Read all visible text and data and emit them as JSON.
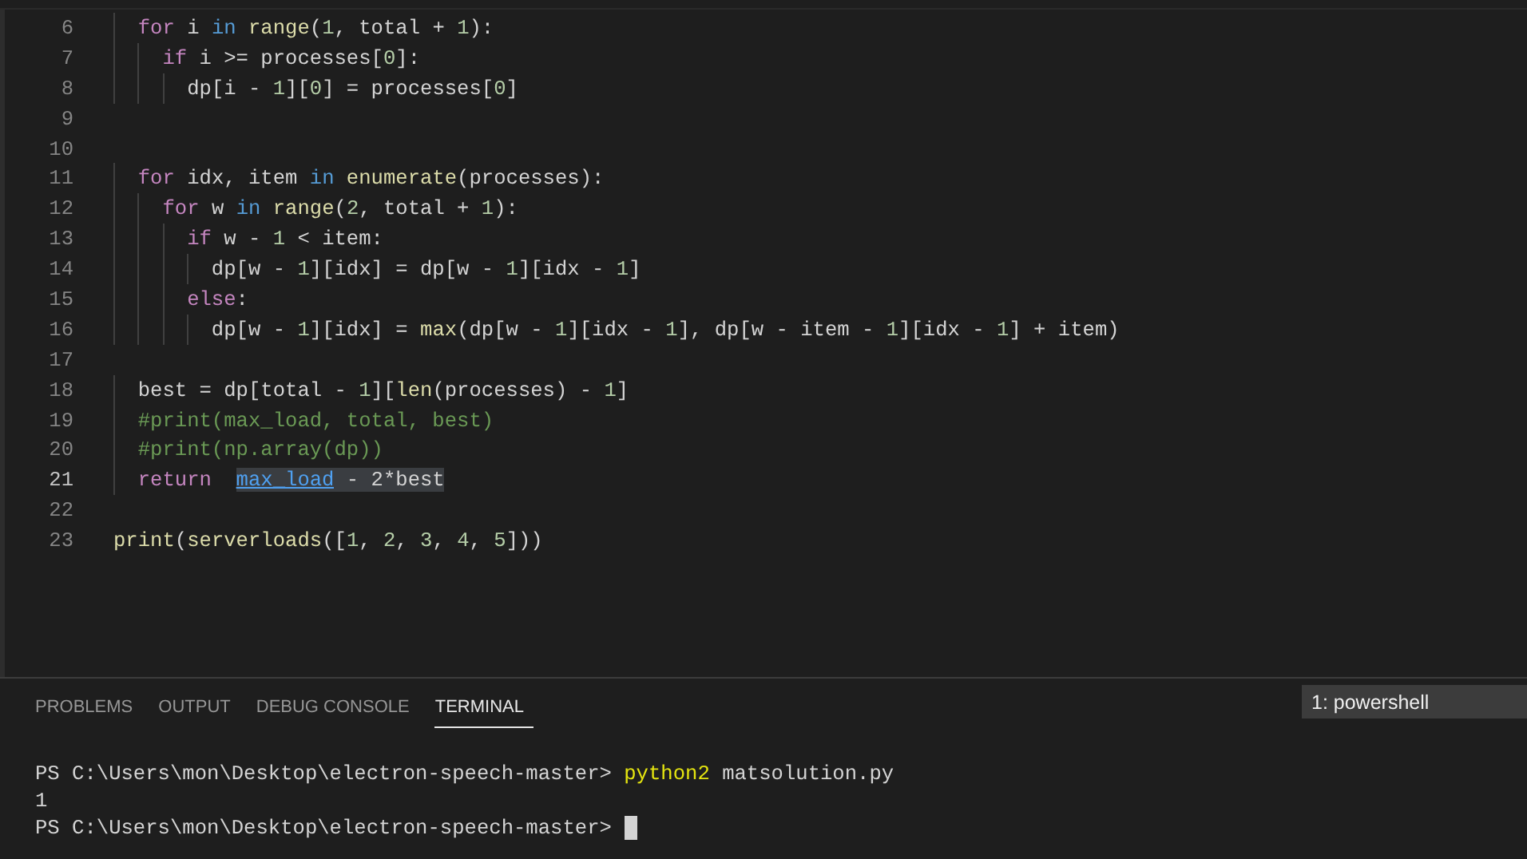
{
  "editor": {
    "lines": [
      {
        "number": "6",
        "current": false,
        "tokens": [
          {
            "t": "  for",
            "kind": "kw"
          },
          {
            "t": " i ",
            "kind": "tx"
          },
          {
            "t": "in",
            "kind": "op"
          },
          {
            "t": " range",
            "kind": "fn"
          },
          {
            "t": "(",
            "kind": "tx"
          },
          {
            "t": "1",
            "kind": "num"
          },
          {
            "t": ", total + ",
            "kind": "tx"
          },
          {
            "t": "1",
            "kind": "num"
          },
          {
            "t": "):",
            "kind": "tx"
          }
        ]
      },
      {
        "number": "7",
        "current": false,
        "tokens": [
          {
            "t": "    if",
            "kind": "kw"
          },
          {
            "t": " i >= processes[",
            "kind": "tx"
          },
          {
            "t": "0",
            "kind": "num"
          },
          {
            "t": "]:",
            "kind": "tx"
          }
        ]
      },
      {
        "number": "8",
        "current": false,
        "tokens": [
          {
            "t": "      dp[i - ",
            "kind": "tx"
          },
          {
            "t": "1",
            "kind": "num"
          },
          {
            "t": "][",
            "kind": "tx"
          },
          {
            "t": "0",
            "kind": "num"
          },
          {
            "t": "] = processes[",
            "kind": "tx"
          },
          {
            "t": "0",
            "kind": "num"
          },
          {
            "t": "]",
            "kind": "tx"
          }
        ]
      },
      {
        "number": "9",
        "current": false
      },
      {
        "number": "10",
        "current": false
      },
      {
        "number": "11",
        "current": false,
        "tokens": [
          {
            "t": "  for",
            "kind": "kw"
          },
          {
            "t": " idx, item ",
            "kind": "tx"
          },
          {
            "t": "in",
            "kind": "op"
          },
          {
            "t": " enumerate",
            "kind": "fn"
          },
          {
            "t": "(processes):",
            "kind": "tx"
          }
        ]
      },
      {
        "number": "12",
        "current": false,
        "tokens": [
          {
            "t": "    for",
            "kind": "kw"
          },
          {
            "t": " w ",
            "kind": "tx"
          },
          {
            "t": "in",
            "kind": "op"
          },
          {
            "t": " range",
            "kind": "fn"
          },
          {
            "t": "(",
            "kind": "tx"
          },
          {
            "t": "2",
            "kind": "num"
          },
          {
            "t": ", total + ",
            "kind": "tx"
          },
          {
            "t": "1",
            "kind": "num"
          },
          {
            "t": "):",
            "kind": "tx"
          }
        ]
      },
      {
        "number": "13",
        "current": false,
        "tokens": [
          {
            "t": "      if",
            "kind": "kw"
          },
          {
            "t": " w - ",
            "kind": "tx"
          },
          {
            "t": "1",
            "kind": "num"
          },
          {
            "t": " < item:",
            "kind": "tx"
          }
        ]
      },
      {
        "number": "14",
        "current": false,
        "tokens": [
          {
            "t": "        dp[w - ",
            "kind": "tx"
          },
          {
            "t": "1",
            "kind": "num"
          },
          {
            "t": "][idx] = dp[w - ",
            "kind": "tx"
          },
          {
            "t": "1",
            "kind": "num"
          },
          {
            "t": "][idx - ",
            "kind": "tx"
          },
          {
            "t": "1",
            "kind": "num"
          },
          {
            "t": "]",
            "kind": "tx"
          }
        ]
      },
      {
        "number": "15",
        "current": false,
        "tokens": [
          {
            "t": "      else",
            "kind": "kw"
          },
          {
            "t": ":",
            "kind": "tx"
          }
        ]
      },
      {
        "number": "16",
        "current": false,
        "tokens": [
          {
            "t": "        dp[w - ",
            "kind": "tx"
          },
          {
            "t": "1",
            "kind": "num"
          },
          {
            "t": "][idx] = ",
            "kind": "tx"
          },
          {
            "t": "max",
            "kind": "fn"
          },
          {
            "t": "(dp[w - ",
            "kind": "tx"
          },
          {
            "t": "1",
            "kind": "num"
          },
          {
            "t": "][idx - ",
            "kind": "tx"
          },
          {
            "t": "1",
            "kind": "num"
          },
          {
            "t": "], dp[w - item - ",
            "kind": "tx"
          },
          {
            "t": "1",
            "kind": "num"
          },
          {
            "t": "][idx - ",
            "kind": "tx"
          },
          {
            "t": "1",
            "kind": "num"
          },
          {
            "t": "] + item)",
            "kind": "tx"
          }
        ]
      },
      {
        "number": "17",
        "current": false
      },
      {
        "number": "18",
        "current": false,
        "tokens": [
          {
            "t": "  best = dp[total - ",
            "kind": "tx"
          },
          {
            "t": "1",
            "kind": "num"
          },
          {
            "t": "][",
            "kind": "tx"
          },
          {
            "t": "len",
            "kind": "fn"
          },
          {
            "t": "(processes) - ",
            "kind": "tx"
          },
          {
            "t": "1",
            "kind": "num"
          },
          {
            "t": "]",
            "kind": "tx"
          }
        ]
      },
      {
        "number": "19",
        "current": false,
        "tokens": [
          {
            "t": "  #print(max_load, total, best)",
            "kind": "cm"
          }
        ]
      },
      {
        "number": "20",
        "current": false,
        "tokens": [
          {
            "t": "  #print(np.array(dp))",
            "kind": "cm"
          }
        ]
      },
      {
        "number": "21",
        "current": true,
        "tokens": [
          {
            "t": "  return  ",
            "kind": "kw"
          },
          {
            "t": "max_load",
            "kind": "link"
          },
          {
            "t": " - ",
            "kind": "hl"
          },
          {
            "t": "2",
            "kind": "hl"
          },
          {
            "t": "*best",
            "kind": "hl"
          }
        ]
      },
      {
        "number": "22",
        "current": false
      },
      {
        "number": "23",
        "current": false,
        "tokens": [
          {
            "t": "print",
            "kind": "fn"
          },
          {
            "t": "(",
            "kind": "tx"
          },
          {
            "t": "serverloads",
            "kind": "fn"
          },
          {
            "t": "([",
            "kind": "tx"
          },
          {
            "t": "1",
            "kind": "num"
          },
          {
            "t": ", ",
            "kind": "tx"
          },
          {
            "t": "2",
            "kind": "num"
          },
          {
            "t": ", ",
            "kind": "tx"
          },
          {
            "t": "3",
            "kind": "num"
          },
          {
            "t": ", ",
            "kind": "tx"
          },
          {
            "t": "4",
            "kind": "num"
          },
          {
            "t": ", ",
            "kind": "tx"
          },
          {
            "t": "5",
            "kind": "num"
          },
          {
            "t": "]))",
            "kind": "tx"
          }
        ]
      }
    ]
  },
  "panel": {
    "tabs": [
      {
        "label": "PROBLEMS",
        "selected": false
      },
      {
        "label": "OUTPUT",
        "selected": false
      },
      {
        "label": "DEBUG CONSOLE",
        "selected": false
      },
      {
        "label": "TERMINAL",
        "selected": true
      }
    ],
    "terminal_picker": "1: powershell",
    "terminal_lines": [
      {
        "segments": [
          {
            "t": "PS C:\\Users\\mon\\Desktop\\electron-speech-master> ",
            "kind": "tx"
          },
          {
            "t": "python2",
            "kind": "cmd"
          },
          {
            "t": " matsolution.py",
            "kind": "tx"
          }
        ],
        "cursor": false
      },
      {
        "segments": [
          {
            "t": "1",
            "kind": "tx"
          }
        ],
        "cursor": false
      },
      {
        "segments": [
          {
            "t": "PS C:\\Users\\mon\\Desktop\\electron-speech-master> ",
            "kind": "tx"
          }
        ],
        "cursor": true
      }
    ]
  }
}
